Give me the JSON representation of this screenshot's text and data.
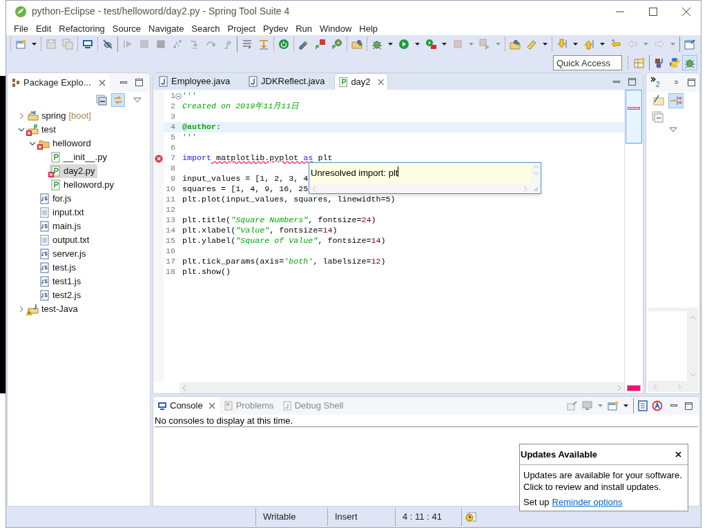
{
  "window": {
    "title": "python-Eclipse - test/helloword/day2.py - Spring Tool Suite 4"
  },
  "menu": [
    "File",
    "Edit",
    "Refactoring",
    "Source",
    "Navigate",
    "Search",
    "Project",
    "Pydev",
    "Run",
    "Window",
    "Help"
  ],
  "quick_access": {
    "placeholder": "Quick Access"
  },
  "package_explorer": {
    "title": "Package Explo...",
    "tree": [
      {
        "label": "spring",
        "suffix": "[boot]",
        "kind": "spring-project",
        "error": false,
        "warning": false,
        "expanded": false,
        "selected": false
      },
      {
        "label": "test",
        "kind": "python-project",
        "error": true,
        "warning": false,
        "expanded": true,
        "selected": false,
        "children": [
          {
            "label": "helloword",
            "kind": "package",
            "error": true,
            "warning": false,
            "expanded": true,
            "selected": false,
            "children": [
              {
                "label": "__init__.py",
                "kind": "python-file",
                "error": false,
                "warning": false,
                "selected": false
              },
              {
                "label": "day2.py",
                "kind": "python-file",
                "error": true,
                "warning": false,
                "selected": true
              },
              {
                "label": "helloword.py",
                "kind": "python-file",
                "error": false,
                "warning": false,
                "selected": false
              }
            ]
          },
          {
            "label": "for.js",
            "kind": "js-file",
            "error": false,
            "warning": false,
            "selected": false
          },
          {
            "label": "input.txt",
            "kind": "text-file",
            "error": false,
            "warning": false,
            "selected": false
          },
          {
            "label": "main.js",
            "kind": "js-file",
            "error": false,
            "warning": false,
            "selected": false
          },
          {
            "label": "output.txt",
            "kind": "text-file",
            "error": false,
            "warning": false,
            "selected": false
          },
          {
            "label": "server.js",
            "kind": "js-file",
            "error": false,
            "warning": false,
            "selected": false
          },
          {
            "label": "test.js",
            "kind": "js-file",
            "error": false,
            "warning": false,
            "selected": false
          },
          {
            "label": "test1.js",
            "kind": "js-file",
            "error": false,
            "warning": false,
            "selected": false
          },
          {
            "label": "test2.js",
            "kind": "js-file",
            "error": false,
            "warning": false,
            "selected": false
          }
        ]
      },
      {
        "label": "test-Java",
        "kind": "java-project",
        "error": false,
        "warning": true,
        "expanded": false,
        "selected": false
      }
    ]
  },
  "editor": {
    "tabs": [
      {
        "label": "Employee.java",
        "kind": "java",
        "selected": false
      },
      {
        "label": "JDKReflect.java",
        "kind": "java",
        "selected": false
      },
      {
        "label": "day2",
        "kind": "python",
        "selected": true
      }
    ],
    "lines": [
      {
        "number": "1",
        "kind": "fold",
        "current": false,
        "segments": [
          {
            "kind": "doc",
            "text": "'''"
          }
        ]
      },
      {
        "number": "2",
        "kind": "plain",
        "current": false,
        "segments": [
          {
            "kind": "doc_italic",
            "text": "Created on 2019年11月11日"
          }
        ]
      },
      {
        "number": "3",
        "kind": "plain",
        "current": false
      },
      {
        "number": "4",
        "kind": "plain",
        "current": true,
        "segments": [
          {
            "kind": "doc_bold",
            "text": "@author:"
          }
        ]
      },
      {
        "number": "5",
        "kind": "plain",
        "current": false,
        "segments": [
          {
            "kind": "doc",
            "text": "'''"
          }
        ]
      },
      {
        "number": "6",
        "kind": "plain",
        "current": false
      },
      {
        "number": "7",
        "kind": "error",
        "current": false,
        "segments": [
          {
            "kind": "keyword",
            "text": "import"
          },
          {
            "kind": "unresolved",
            "text": " matplotlib.pyplot "
          },
          {
            "kind": "unresolved_keyword",
            "text": "as"
          },
          {
            "kind": "plain",
            "text": " plt"
          }
        ]
      },
      {
        "number": "8",
        "kind": "plain",
        "current": false
      },
      {
        "number": "9",
        "kind": "plain",
        "current": false,
        "segments": [
          {
            "kind": "plain",
            "text": "input_values = [1, 2, 3, 4"
          }
        ]
      },
      {
        "number": "10",
        "kind": "plain",
        "current": false,
        "segments": [
          {
            "kind": "plain",
            "text": "squares = [1, 4, 9, 16, 25"
          }
        ]
      },
      {
        "number": "11",
        "kind": "plain",
        "current": false,
        "segments": [
          {
            "kind": "plain",
            "text": "plt.plot(input_values, squares, linewidth=5)"
          }
        ]
      },
      {
        "number": "12",
        "kind": "plain",
        "current": false
      },
      {
        "number": "13",
        "kind": "plain",
        "current": false,
        "segments": [
          {
            "kind": "plain",
            "text": "plt.title("
          },
          {
            "kind": "string",
            "text": "\"Square Numbers\""
          },
          {
            "kind": "plain",
            "text": ", fontsize="
          },
          {
            "kind": "number",
            "text": "24"
          },
          {
            "kind": "plain",
            "text": ")"
          }
        ]
      },
      {
        "number": "14",
        "kind": "plain",
        "current": false,
        "segments": [
          {
            "kind": "plain",
            "text": "plt.xlabel("
          },
          {
            "kind": "string",
            "text": "\"Value\""
          },
          {
            "kind": "plain",
            "text": ", fontsize="
          },
          {
            "kind": "number",
            "text": "14"
          },
          {
            "kind": "plain",
            "text": ")"
          }
        ]
      },
      {
        "number": "15",
        "kind": "plain",
        "current": false,
        "segments": [
          {
            "kind": "plain",
            "text": "plt.ylabel("
          },
          {
            "kind": "string",
            "text": "\"Square of Value\""
          },
          {
            "kind": "plain",
            "text": ", fontsize="
          },
          {
            "kind": "number",
            "text": "14"
          },
          {
            "kind": "plain",
            "text": ")"
          }
        ]
      },
      {
        "number": "16",
        "kind": "plain",
        "current": false
      },
      {
        "number": "17",
        "kind": "plain",
        "current": false,
        "segments": [
          {
            "kind": "plain",
            "text": "plt.tick_params(axis="
          },
          {
            "kind": "string",
            "text": "'both'"
          },
          {
            "kind": "plain",
            "text": ", labelsize="
          },
          {
            "kind": "number",
            "text": "12"
          },
          {
            "kind": "plain",
            "text": ")"
          }
        ]
      },
      {
        "number": "18",
        "kind": "plain",
        "current": false,
        "segments": [
          {
            "kind": "plain",
            "text": "plt.show()"
          }
        ]
      }
    ],
    "popup": {
      "text": "Unresolved import: plt"
    }
  },
  "side_panel": {
    "overflow_count": "2"
  },
  "console": {
    "tabs": [
      {
        "label": "Console",
        "selected": true
      },
      {
        "label": "Problems",
        "selected": false
      },
      {
        "label": "Debug Shell",
        "selected": false
      }
    ],
    "message": "No consoles to display at this time."
  },
  "status_bar": [
    "Writable",
    "Insert",
    "4 : 11 : 41"
  ],
  "notification": {
    "title": "Updates Available",
    "body": [
      "Updates are available for your software.",
      "Click to review and install updates."
    ],
    "prefix": "Set up",
    "link": "Reminder options"
  }
}
